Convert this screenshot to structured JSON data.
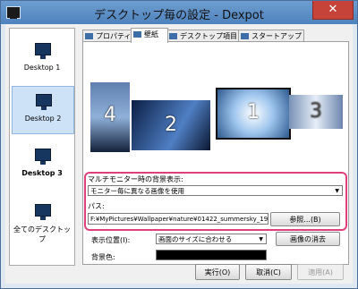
{
  "window": {
    "title": "デスクトップ毎の設定 - Dexpot",
    "close_glyph": "✕"
  },
  "sidebar": {
    "items": [
      {
        "label": "Desktop 1"
      },
      {
        "label": "Desktop 2",
        "selected": true
      },
      {
        "label": "Desktop 3",
        "bold": true
      },
      {
        "label": "全てのデスクトップ"
      }
    ]
  },
  "tabs": [
    {
      "label": "プロパティ"
    },
    {
      "label": "壁紙",
      "active": true
    },
    {
      "label": "デスクトップ項目"
    },
    {
      "label": "スタートアップ"
    }
  ],
  "monitors": [
    "4",
    "2",
    "1",
    "3"
  ],
  "wallpaper": {
    "multi_monitor_label": "マルチモニター時の背景表示:",
    "multi_monitor_value": "モニター毎に異なる画像を使用",
    "path_label": "パス:",
    "path_value": "F:¥MyPictures¥Wallpaper¥nature¥01422_summersky_192",
    "browse_label": "参照...(B)",
    "display_position_label": "表示位置(I):",
    "display_position_value": "画面のサイズに合わせる",
    "clear_image_label": "画像の消去",
    "bg_color_label": "背景色:",
    "bg_color": "#000000"
  },
  "footer": {
    "apply_label": "実行(O)",
    "cancel_label": "取消(C)",
    "apply2_label": "適用(A)"
  },
  "colors": {
    "highlight": "#e0407a",
    "title_bar": "#5b8cc6",
    "close": "#c6433a"
  }
}
